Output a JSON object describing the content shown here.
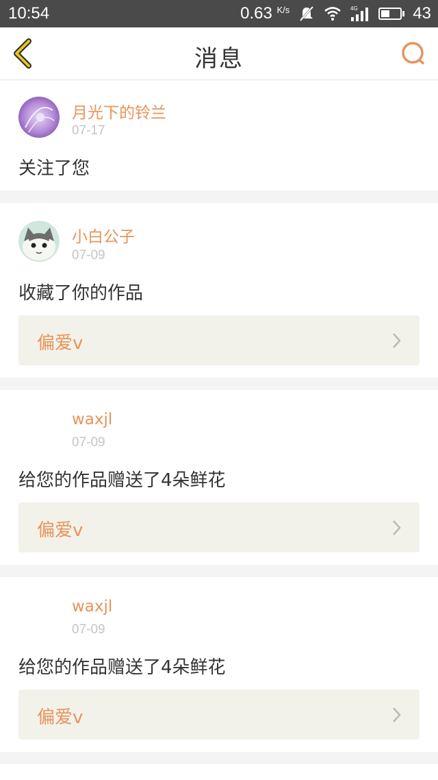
{
  "status_bar": {
    "time": "10:54",
    "speed": "0.63",
    "speed_unit": "K/s",
    "network": "4G",
    "battery": "43"
  },
  "nav": {
    "title": "消息",
    "back_icon": "back-chevron-icon",
    "search_icon": "search-icon"
  },
  "colors": {
    "accent": "#e8935a",
    "back_yellow": "#e8c71a"
  },
  "messages": [
    {
      "user": "月光下的铃兰",
      "date": "07-17",
      "action": "关注了您"
    },
    {
      "user": "小白公子",
      "date": "07-09",
      "action": "收藏了你的作品",
      "work": "偏爱v"
    },
    {
      "user": "waxjl",
      "date": "07-09",
      "action": "给您的作品赠送了4朵鲜花",
      "work": "偏爱v"
    },
    {
      "user": "waxjl",
      "date": "07-09",
      "action": "给您的作品赠送了4朵鲜花",
      "work": "偏爱v"
    }
  ]
}
